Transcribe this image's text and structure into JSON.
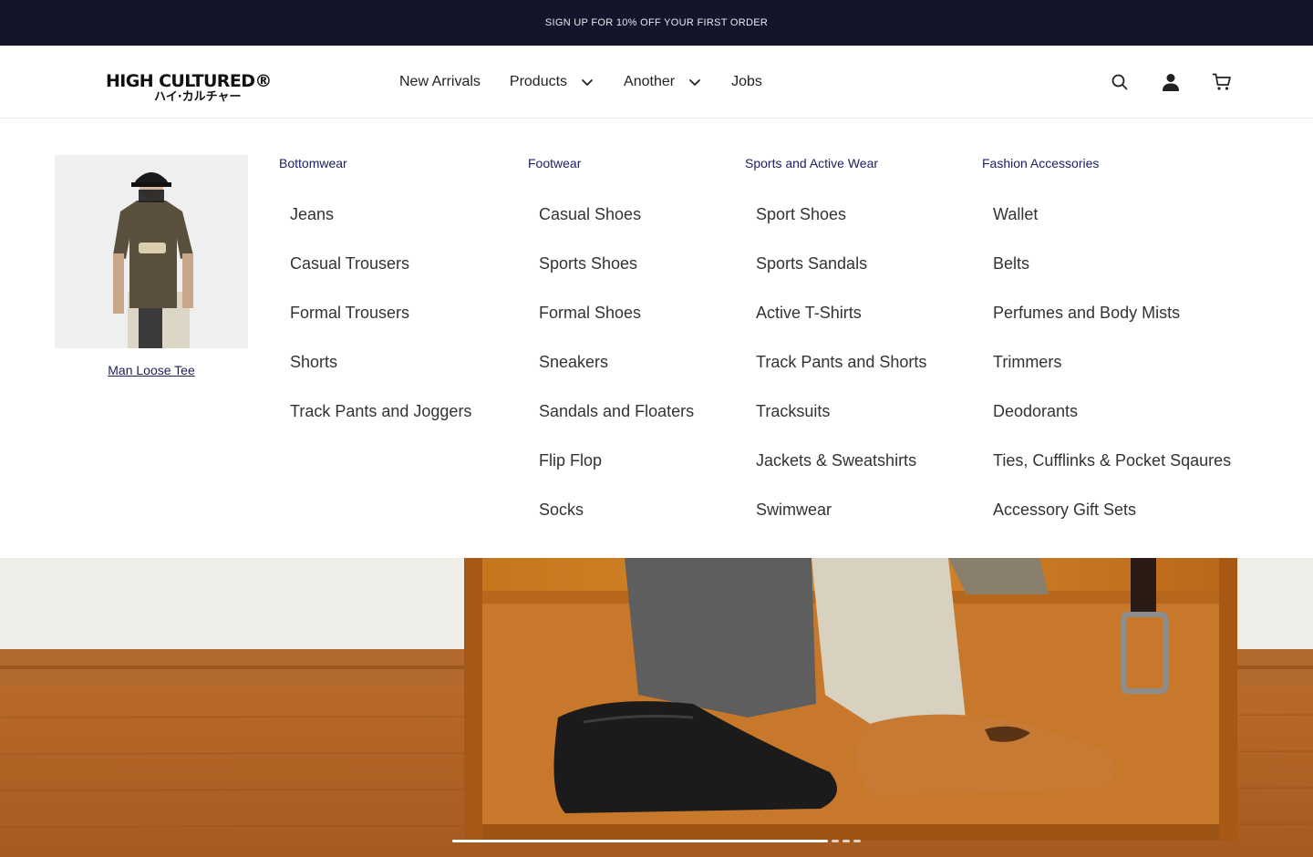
{
  "announcement": "SIGN UP FOR 10% OFF YOUR FIRST ORDER",
  "brand": {
    "name_line1": "HIGH CULTURED®",
    "name_line2": "ハイ·カルチャー"
  },
  "nav": {
    "items": [
      {
        "label": "New Arrivals",
        "has_dropdown": false
      },
      {
        "label": "Products",
        "has_dropdown": true
      },
      {
        "label": "Another",
        "has_dropdown": true
      },
      {
        "label": "Jobs",
        "has_dropdown": false
      }
    ]
  },
  "header_icons": [
    "search-icon",
    "user-icon",
    "cart-icon"
  ],
  "mega_menu": {
    "promo": {
      "caption": "Man Loose Tee"
    },
    "columns": [
      {
        "heading": "Bottomwear",
        "items": [
          "Jeans",
          "Casual Trousers",
          "Formal Trousers",
          "Shorts",
          "Track Pants and Joggers"
        ]
      },
      {
        "heading": "Footwear",
        "items": [
          "Casual Shoes",
          "Sports Shoes",
          "Formal Shoes",
          "Sneakers",
          "Sandals and Floaters",
          "Flip Flop",
          "Socks"
        ]
      },
      {
        "heading": "Sports and Active Wear",
        "items": [
          "Sport Shoes",
          "Sports Sandals",
          "Active T-Shirts",
          "Track Pants and Shorts",
          "Tracksuits",
          "Jackets & Sweatshirts",
          "Swimwear"
        ]
      },
      {
        "heading": "Fashion Accessories",
        "items": [
          "Wallet",
          "Belts",
          "Perfumes and Body Mists",
          "Trimmers",
          "Deodorants",
          "Ties, Cufflinks & Pocket Sqaures",
          "Accessory Gift Sets"
        ]
      }
    ]
  },
  "carousel": {
    "slide_count": 4,
    "active_slide": 1
  },
  "colors": {
    "announcement_bg": "#14152b",
    "heading_accent": "#1d2260",
    "text": "#222222"
  }
}
